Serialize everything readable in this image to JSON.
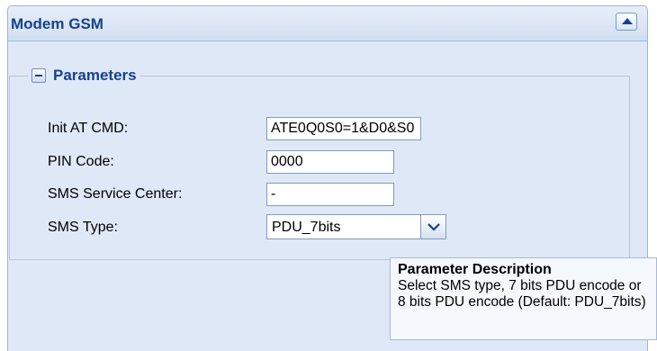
{
  "panel": {
    "title": "Modem GSM"
  },
  "fieldset": {
    "legend": "Parameters"
  },
  "fields": {
    "init_at_cmd": {
      "label": "Init AT CMD:",
      "value": "ATE0Q0S0=1&D0&S0"
    },
    "pin_code": {
      "label": "PIN Code:",
      "value": "0000"
    },
    "sms_service_center": {
      "label": "SMS Service Center:",
      "value": "-"
    },
    "sms_type": {
      "label": "SMS Type:",
      "value": "PDU_7bits"
    }
  },
  "tooltip": {
    "title": "Parameter Description",
    "body": "Select SMS type, 7 bits PDU encode or 8 bits PDU encode (Default: PDU_7bits)"
  },
  "icons": {
    "collapse": "triangle-up-icon",
    "fieldset_toggle": "minus-icon",
    "dropdown": "chevron-down-icon"
  },
  "colors": {
    "title": "#15428b",
    "panel_bg": "#dfe8f6",
    "border": "#99bbe8"
  }
}
